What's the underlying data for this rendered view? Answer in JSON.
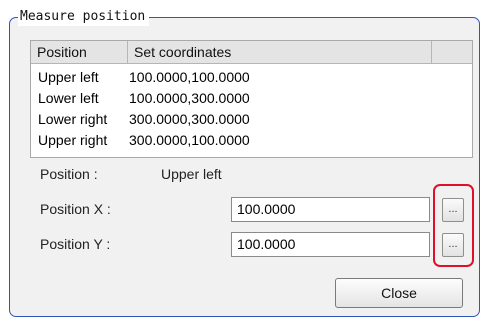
{
  "group": {
    "title": "Measure position"
  },
  "table": {
    "headers": [
      "Position",
      "Set coordinates",
      ""
    ],
    "rows": [
      {
        "position": "Upper left",
        "coords": "100.0000,100.0000"
      },
      {
        "position": "Lower left",
        "coords": "100.0000,300.0000"
      },
      {
        "position": "Lower right",
        "coords": "300.0000,300.0000"
      },
      {
        "position": "Upper right",
        "coords": "300.0000,100.0000"
      }
    ]
  },
  "position": {
    "label": "Position :",
    "value": "Upper left"
  },
  "position_x": {
    "label": "Position X :",
    "value": "100.0000",
    "button": "..."
  },
  "position_y": {
    "label": "Position Y :",
    "value": "100.0000",
    "button": "..."
  },
  "close_label": "Close",
  "colors": {
    "group_border": "#2f56b8",
    "highlight": "#e0102a"
  }
}
